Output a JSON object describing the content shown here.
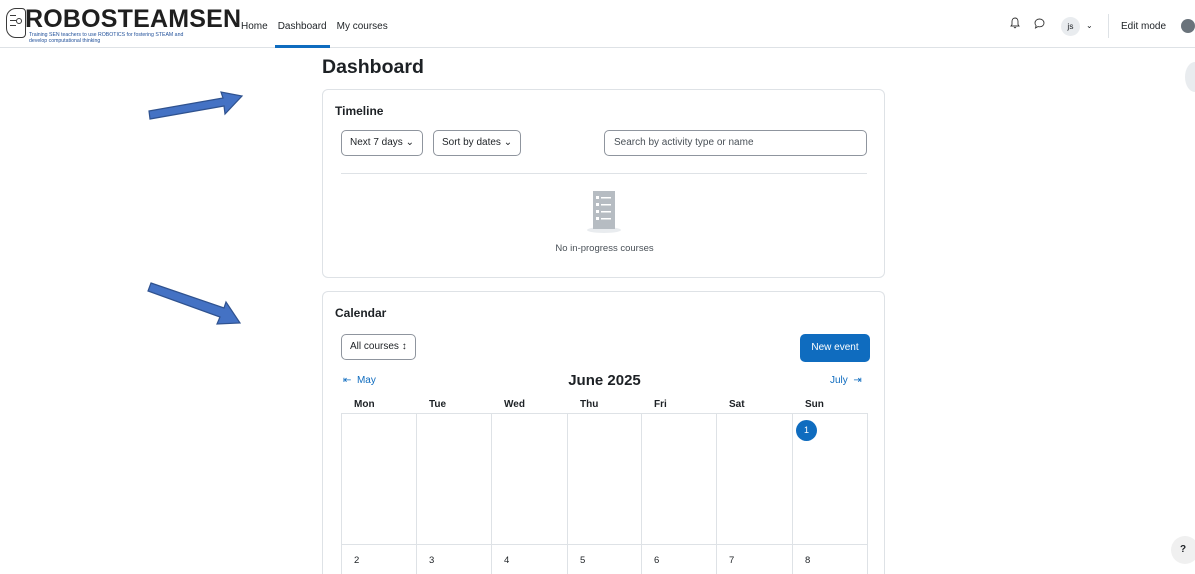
{
  "brand": {
    "title": "ROBOSTEAMSEN",
    "subtitle_line1": "Training SEN teachers to use ROBOTICS for fostering STEAM and",
    "subtitle_line2": "develop computational thinking"
  },
  "nav": {
    "links": [
      {
        "label": "Home",
        "active": false
      },
      {
        "label": "Dashboard",
        "active": true
      },
      {
        "label": "My courses",
        "active": false
      }
    ],
    "user_initials": "js",
    "edit_mode_label": "Edit mode",
    "accent_color": "#0f6cbf"
  },
  "page": {
    "title": "Dashboard"
  },
  "timeline": {
    "title": "Timeline",
    "filter_label": "Next 7 days",
    "sort_label": "Sort by dates",
    "search_placeholder": "Search by activity type or name",
    "empty_text": "No in-progress courses"
  },
  "calendar": {
    "title": "Calendar",
    "course_select": "All courses",
    "new_event_label": "New event",
    "prev_month": "May",
    "next_month": "July",
    "month_title": "June 2025",
    "weekdays": [
      "Mon",
      "Tue",
      "Wed",
      "Thu",
      "Fri",
      "Sat",
      "Sun"
    ],
    "week1": [
      "",
      "",
      "",
      "",
      "",
      "",
      "1"
    ],
    "week2": [
      "2",
      "3",
      "4",
      "5",
      "6",
      "7",
      "8"
    ],
    "today": "1"
  },
  "help_label": "?"
}
